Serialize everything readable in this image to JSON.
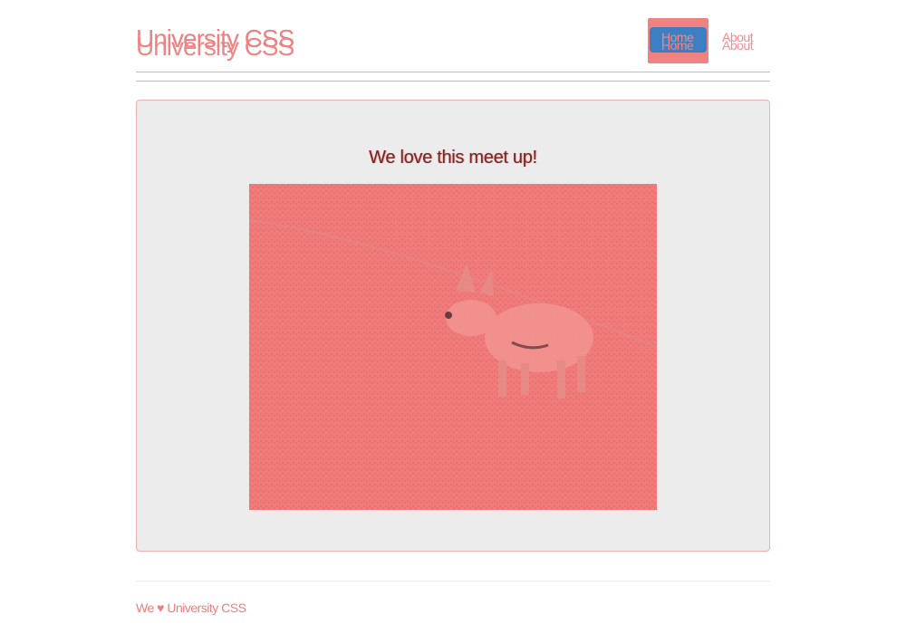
{
  "site": {
    "title": "University CSS"
  },
  "nav": {
    "items": [
      {
        "label": "Home",
        "active": true
      },
      {
        "label": "About",
        "active": false
      }
    ]
  },
  "main": {
    "heading": "We love this meet up!",
    "image": {
      "subject": "goat-photo"
    }
  },
  "footer": {
    "text": "We ♥ University CSS"
  },
  "colors": {
    "accent": "#f07f7f",
    "active_pill": "#3d7fc0",
    "card_background": "#ececec",
    "heading_text": "#7a2424"
  }
}
